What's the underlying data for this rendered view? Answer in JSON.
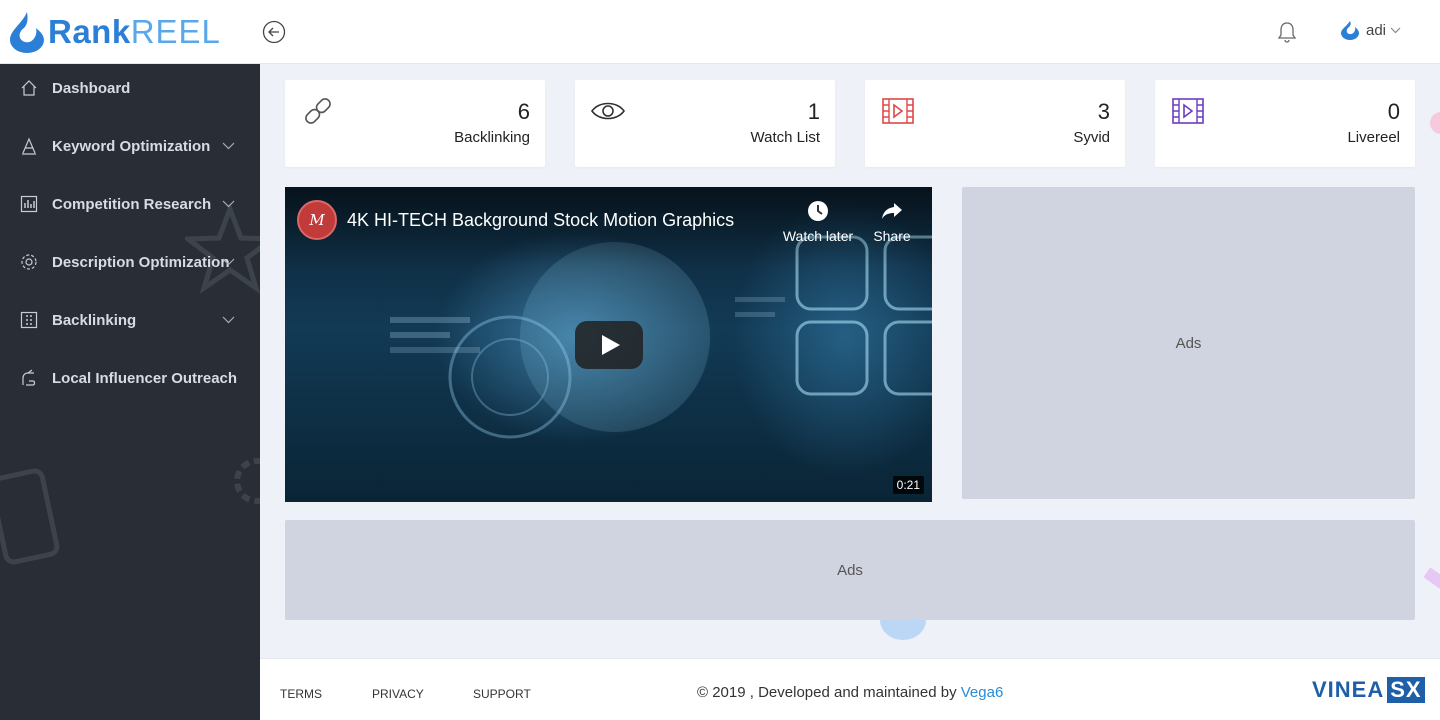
{
  "header": {
    "logo_part1": "Rank",
    "logo_part2": "REEL",
    "user_name": "adi"
  },
  "sidebar": {
    "items": [
      {
        "label": "Dashboard",
        "icon": "home-icon",
        "has_submenu": false
      },
      {
        "label": "Keyword Optimization",
        "icon": "text-a-icon",
        "has_submenu": true
      },
      {
        "label": "Competition Research",
        "icon": "bar-chart-icon",
        "has_submenu": true
      },
      {
        "label": "Description Optimization",
        "icon": "gear-icon",
        "has_submenu": true
      },
      {
        "label": "Backlinking",
        "icon": "grid-icon",
        "has_submenu": true
      },
      {
        "label": "Local Influencer Outreach",
        "icon": "hand-icon",
        "has_submenu": false
      }
    ]
  },
  "stats": [
    {
      "value": "6",
      "label": "Backlinking",
      "icon": "link-icon",
      "color": "#555555"
    },
    {
      "value": "1",
      "label": "Watch List",
      "icon": "eye-icon",
      "color": "#333333"
    },
    {
      "value": "3",
      "label": "Syvid",
      "icon": "film-icon",
      "color": "#e04848"
    },
    {
      "value": "0",
      "label": "Livereel",
      "icon": "film-icon",
      "color": "#6a3fc0"
    }
  ],
  "video": {
    "title": "4K HI-TECH Background Stock Motion Graphics",
    "channel_avatar_letter": "M",
    "watch_later_label": "Watch later",
    "share_label": "Share",
    "duration": "0:21"
  },
  "ads": {
    "side_label": "Ads",
    "bottom_label": "Ads"
  },
  "footer": {
    "terms": "TERMS",
    "privacy": "PRIVACY",
    "support": "SUPPORT",
    "copyright": "© 2019 , Developed and maintained by ",
    "developer_link": "Vega6",
    "brand_part1": "VINEA",
    "brand_part2": "SX"
  },
  "colors": {
    "sidebar_bg": "#292d36",
    "page_bg": "#eef1f7",
    "ad_bg": "#d0d4e0",
    "accent_blue": "#2b7fd6",
    "syvid_red": "#e04848",
    "livereel_purple": "#6a3fc0"
  }
}
